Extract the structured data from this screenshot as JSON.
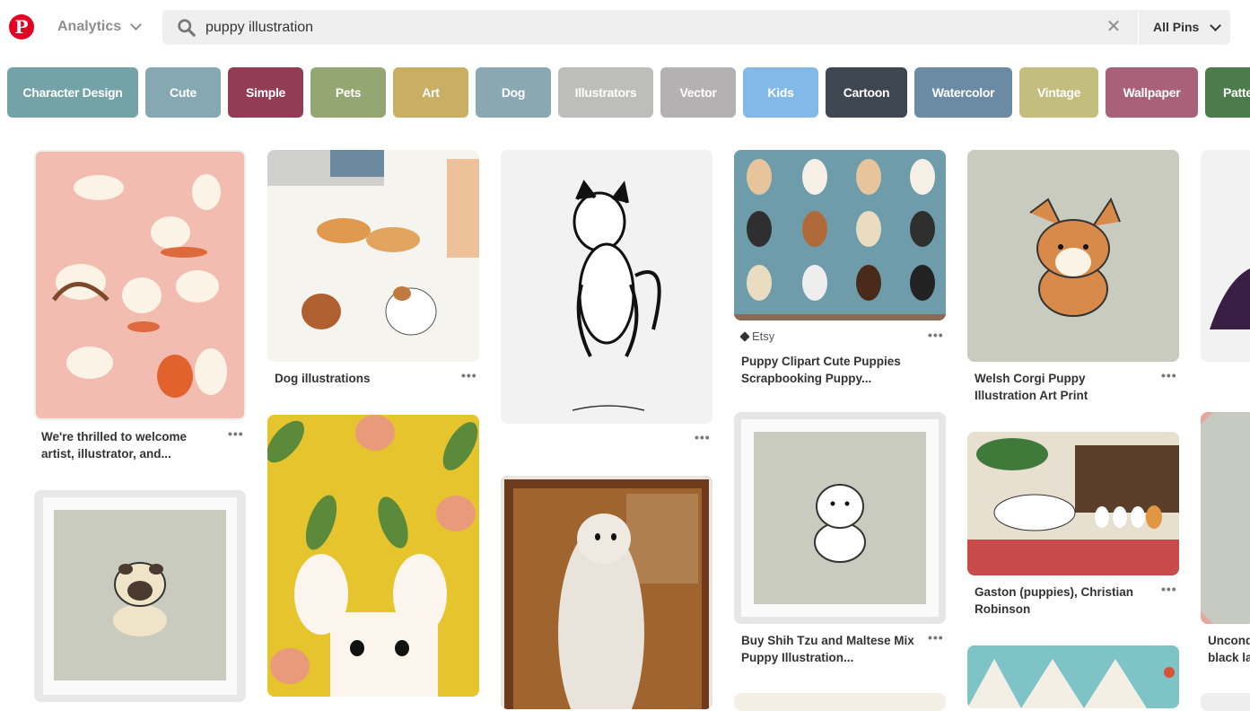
{
  "header": {
    "logo_letter": "P",
    "analytics_label": "Analytics",
    "search_value": "puppy illustration",
    "clear_symbol": "✕",
    "scope_label": "All Pins"
  },
  "guides": [
    {
      "label": "Character Design",
      "color": "#73a3a6"
    },
    {
      "label": "Cute",
      "color": "#86a8b2"
    },
    {
      "label": "Simple",
      "color": "#923c56"
    },
    {
      "label": "Pets",
      "color": "#94a672"
    },
    {
      "label": "Art",
      "color": "#c9af64"
    },
    {
      "label": "Dog",
      "color": "#8aa8b2"
    },
    {
      "label": "Illustrators",
      "color": "#bdbdb9"
    },
    {
      "label": "Vector",
      "color": "#b3b1b1"
    },
    {
      "label": "Kids",
      "color": "#83b9e8"
    },
    {
      "label": "Cartoon",
      "color": "#3e4650"
    },
    {
      "label": "Watercolor",
      "color": "#6a8ba3"
    },
    {
      "label": "Vintage",
      "color": "#c3bd7e"
    },
    {
      "label": "Wallpaper",
      "color": "#a86179"
    },
    {
      "label": "Patte",
      "color": "#4c7c4b"
    }
  ],
  "pins": {
    "p1": {
      "title": "We're thrilled to welcome artist, illustrator, and...",
      "more": "•••"
    },
    "p2": {
      "title": "Dog illustrations",
      "more": "•••"
    },
    "p3": {
      "more": "•••"
    },
    "p4": {
      "source": "Etsy",
      "title": "Puppy Clipart Cute Puppies Scrapbooking Puppy...",
      "more": "•••"
    },
    "p5": {
      "title": "Welsh Corgi Puppy Illustration Art Print",
      "more": "•••"
    },
    "p6": {
      "title": "Buy Shih Tzu and Maltese Mix Puppy Illustration...",
      "more": "•••"
    },
    "p7": {
      "title": "Gaston (puppies), Christian Robinson",
      "more": "•••"
    },
    "p8": {
      "title": "Uncond black la",
      "more": ""
    }
  }
}
